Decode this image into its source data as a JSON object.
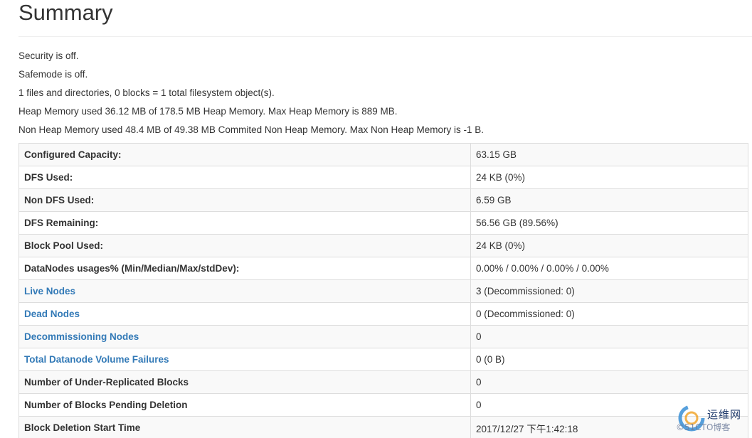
{
  "title": "Summary",
  "status_lines": [
    "Security is off.",
    "Safemode is off.",
    "1 files and directories, 0 blocks = 1 total filesystem object(s).",
    "Heap Memory used 36.12 MB of 178.5 MB Heap Memory. Max Heap Memory is 889 MB.",
    "Non Heap Memory used 48.4 MB of 49.38 MB Commited Non Heap Memory. Max Non Heap Memory is -1 B."
  ],
  "table": {
    "rows": [
      {
        "key": "Configured Capacity:",
        "value": "63.15 GB"
      },
      {
        "key": "DFS Used:",
        "value": "24 KB (0%)"
      },
      {
        "key": "Non DFS Used:",
        "value": "6.59 GB"
      },
      {
        "key": "DFS Remaining:",
        "value": "56.56 GB (89.56%)"
      },
      {
        "key": "Block Pool Used:",
        "value": "24 KB (0%)"
      },
      {
        "key": "DataNodes usages% (Min/Median/Max/stdDev):",
        "value": "0.00% / 0.00% / 0.00% / 0.00%"
      },
      {
        "key": "Live Nodes",
        "value": "3 (Decommissioned: 0)"
      },
      {
        "key": "Dead Nodes",
        "value": "0 (Decommissioned: 0)"
      },
      {
        "key": "Decommissioning Nodes",
        "value": "0"
      },
      {
        "key": "Total Datanode Volume Failures",
        "value": "0 (0 B)"
      },
      {
        "key": "Number of Under-Replicated Blocks",
        "value": "0"
      },
      {
        "key": "Number of Blocks Pending Deletion",
        "value": "0"
      },
      {
        "key": "Block Deletion Start Time",
        "value": "2017/12/27 下午1:42:18"
      }
    ]
  },
  "watermark": {
    "name": "运维网",
    "subtitle": "©51CTO博客"
  },
  "colors": {
    "link": "#337ab7",
    "text": "#333333",
    "border": "#dddddd",
    "stripe": "#f9f9f9"
  }
}
